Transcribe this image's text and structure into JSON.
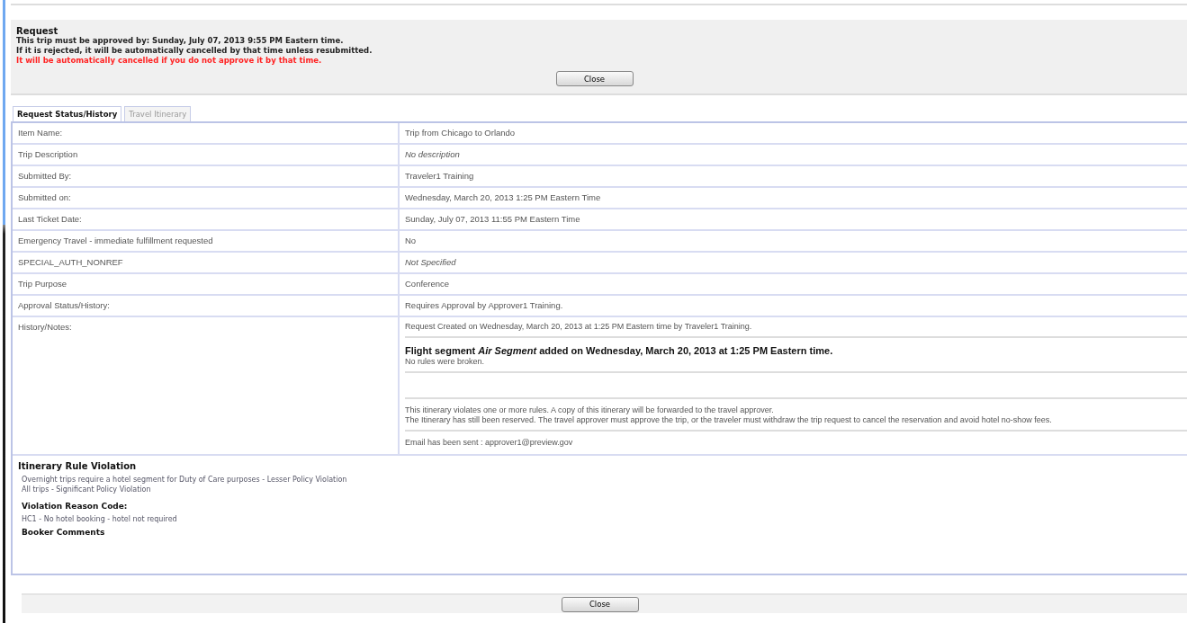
{
  "request": {
    "title": "Request",
    "lines": [
      {
        "text": "This trip must be approved by: Sunday, July 07, 2013 9:55 PM Eastern time.",
        "kind": "normal"
      },
      {
        "text": "If it is rejected, it will be automatically cancelled by that time unless resubmitted.",
        "kind": "normal"
      },
      {
        "text": "It will be automatically cancelled if you do not approve it by that time.",
        "kind": "warning"
      }
    ],
    "button": "Close"
  },
  "tabs": [
    {
      "label": "Request Status/History",
      "selected": true
    },
    {
      "label": "Travel Itinerary",
      "selected": false
    }
  ],
  "details": [
    {
      "label": "Item Name:",
      "value": "Trip from Chicago to Orlando",
      "kind": "text"
    },
    {
      "label": "Trip Description",
      "value": "No description",
      "kind": "empty"
    },
    {
      "label": "Submitted By:",
      "value": "Traveler1 Training",
      "kind": "text"
    },
    {
      "label": "Submitted on:",
      "value": "Wednesday, March 20, 2013 1:25 PM Eastern Time",
      "kind": "text"
    },
    {
      "label": "Last Ticket Date:",
      "value": "Sunday, July 07, 2013 11:55 PM Eastern Time",
      "kind": "text"
    },
    {
      "label": "Emergency Travel - immediate fulfillment requested",
      "value": "No",
      "kind": "text"
    },
    {
      "label": "SPECIAL_AUTH_NONREF",
      "value": "Not Specified",
      "kind": "empty"
    },
    {
      "label": "Trip Purpose",
      "value": "Conference",
      "kind": "text"
    },
    {
      "label": "Approval Status/History:",
      "value": "Requires Approval by Approver1 Training.",
      "kind": "text"
    }
  ],
  "history": {
    "label": "History/Notes:",
    "entries": [
      {
        "kind": "note",
        "lines": [
          "Request Created on Wednesday, March 20, 2013 at 1:25 PM Eastern time by Traveler1 Training."
        ]
      },
      {
        "kind": "segment",
        "heading": "Flight segment *Air Segment* added on Wednesday, March 20, 2013 at 1:25 PM Eastern time.",
        "lines": [
          "No rules were broken."
        ]
      },
      {
        "kind": "blank"
      },
      {
        "kind": "note",
        "lines": [
          "This itinerary violates one or more rules. A copy of this itinerary will be forwarded to the travel approver.",
          "The Itinerary has still been reserved. The travel approver must approve the trip, or the traveler must withdraw the trip request to cancel the reservation and avoid hotel no-show fees."
        ]
      },
      {
        "kind": "note",
        "lines": [
          "Email has been sent : approver1@preview.gov"
        ]
      }
    ]
  },
  "violation": {
    "title": "Itinerary Rule Violation",
    "rules": [
      "Overnight trips require a hotel segment for Duty of Care purposes - Lesser Policy Violation",
      "All trips - Significant Policy Violation"
    ],
    "reason_title": "Violation Reason Code:",
    "reason": "HC1 - No hotel booking - hotel not required",
    "comments_title": "Booker Comments"
  },
  "footer": {
    "button": "Close"
  }
}
